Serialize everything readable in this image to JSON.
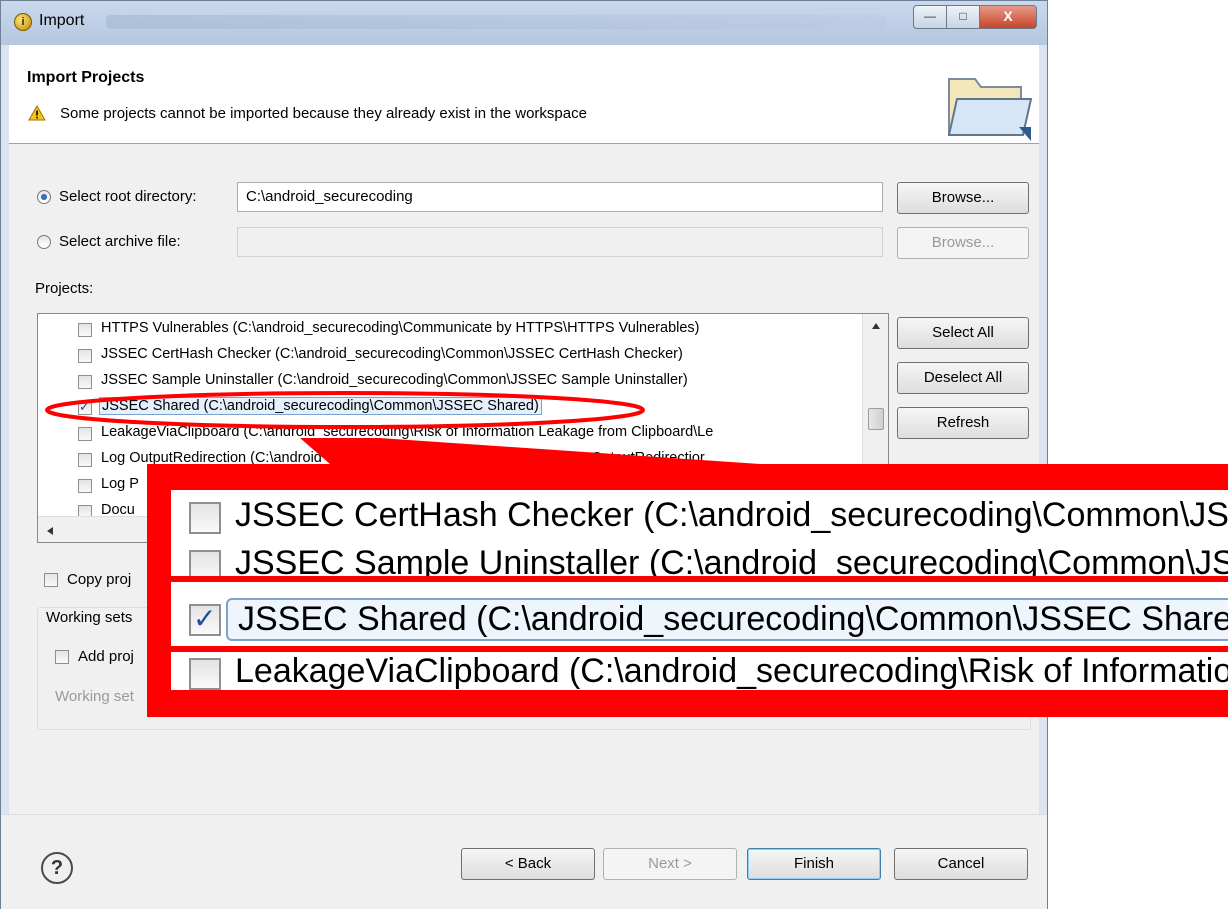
{
  "window": {
    "title": "Import",
    "minimize_label": "—",
    "maximize_label": "□",
    "close_label": "X"
  },
  "banner": {
    "title": "Import Projects",
    "message": "Some projects cannot be imported because they already exist in the workspace"
  },
  "source": {
    "root_label": "Select root directory:",
    "root_value": "C:\\android_securecoding",
    "archive_label": "Select archive file:",
    "browse_label": "Browse...",
    "browse_archive_label": "Browse..."
  },
  "projects": {
    "label": "Projects:",
    "items": [
      {
        "label": "HTTPS Vulnerables (C:\\android_securecoding\\Communicate by HTTPS\\HTTPS Vulnerables)",
        "checked": false
      },
      {
        "label": "JSSEC CertHash Checker (C:\\android_securecoding\\Common\\JSSEC CertHash Checker)",
        "checked": false
      },
      {
        "label": "JSSEC Sample Uninstaller (C:\\android_securecoding\\Common\\JSSEC Sample Uninstaller)",
        "checked": false
      },
      {
        "label": "JSSEC Shared (C:\\android_securecoding\\Common\\JSSEC Shared)",
        "checked": true
      },
      {
        "label": "LeakageViaClipboard (C:\\android_securecoding\\Risk of Information Leakage from Clipboard\\Le",
        "checked": false
      },
      {
        "label": "Log OutputRedirection (C:\\android_securecoding\\Output Log to LogCat\\Log OutputRedirectior",
        "checked": false
      },
      {
        "label": "Log P",
        "checked": false
      },
      {
        "label": "Docu",
        "checked": false
      }
    ],
    "select_all": "Select All",
    "deselect_all": "Deselect All",
    "refresh": "Refresh"
  },
  "options": {
    "copy_label": "Copy proj",
    "working_sets_label": "Working sets",
    "add_label": "Add proj",
    "working_set_label": "Working set"
  },
  "zoom": {
    "items": [
      {
        "label": "JSSEC CertHash Checker (C:\\android_securecoding\\Common\\JSSEC",
        "checked": false
      },
      {
        "label": "JSSEC Sample Uninstaller (C:\\android_securecoding\\Common\\JSSE",
        "checked": false
      },
      {
        "label": "JSSEC Shared (C:\\android_securecoding\\Common\\JSSEC Shared)",
        "checked": true
      },
      {
        "label": "LeakageViaClipboard (C:\\android_securecoding\\Risk of Informatior",
        "checked": false
      }
    ]
  },
  "footer": {
    "help_label": "?",
    "back_label": "< Back",
    "next_label": "Next >",
    "finish_label": "Finish",
    "cancel_label": "Cancel"
  },
  "colors": {
    "highlight": "#ff0000",
    "selection": "#e5f0fb"
  }
}
